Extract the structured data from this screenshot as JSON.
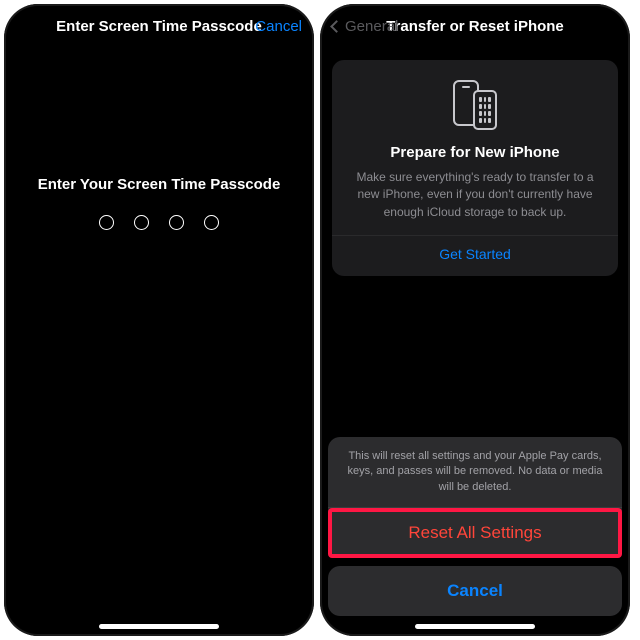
{
  "left": {
    "nav": {
      "title": "Enter Screen Time Passcode",
      "cancel": "Cancel"
    },
    "prompt": "Enter Your Screen Time Passcode",
    "passcode_length": 4
  },
  "right": {
    "nav": {
      "back": "General",
      "title": "Transfer or Reset iPhone"
    },
    "prepare": {
      "title": "Prepare for New iPhone",
      "desc": "Make sure everything's ready to transfer to a new iPhone, even if you don't currently have enough iCloud storage to back up.",
      "get_started": "Get Started"
    },
    "sheet": {
      "message": "This will reset all settings and your Apple Pay cards, keys, and passes will be removed. No data or media will be deleted.",
      "action": "Reset All Settings",
      "cancel": "Cancel"
    }
  }
}
